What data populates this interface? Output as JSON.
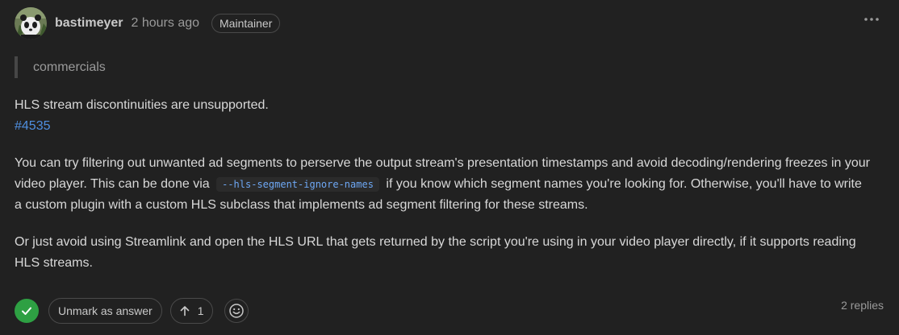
{
  "comment": {
    "author": "bastimeyer",
    "timestamp": "2 hours ago",
    "role_badge": "Maintainer",
    "quote": "commercials",
    "p1_text": "HLS stream discontinuities are unsupported.",
    "p1_link": "#4535",
    "p2_before_code": "You can try filtering out unwanted ad segments to perserve the output stream's presentation timestamps and avoid decoding/rendering freezes in your video player. This can be done via",
    "p2_code": "--hls-segment-ignore-names",
    "p2_after_code": "if you know which segment names you're looking for. Otherwise, you'll have to write a custom plugin with a custom HLS subclass that implements ad segment filtering for these streams.",
    "p3_text": "Or just avoid using Streamlink and open the HLS URL that gets returned by the script you're using in your video player directly, if it supports reading HLS streams."
  },
  "footer": {
    "unmark_label": "Unmark as answer",
    "upvote_count": "1",
    "replies_label": "2 replies"
  },
  "colors": {
    "background": "#212121",
    "link": "#4f8fe0",
    "answered_green": "#2ea043"
  },
  "icons": {
    "more": "kebab-horizontal-icon",
    "answered": "check-icon",
    "upvote": "arrow-up-icon",
    "reaction": "smiley-icon"
  }
}
